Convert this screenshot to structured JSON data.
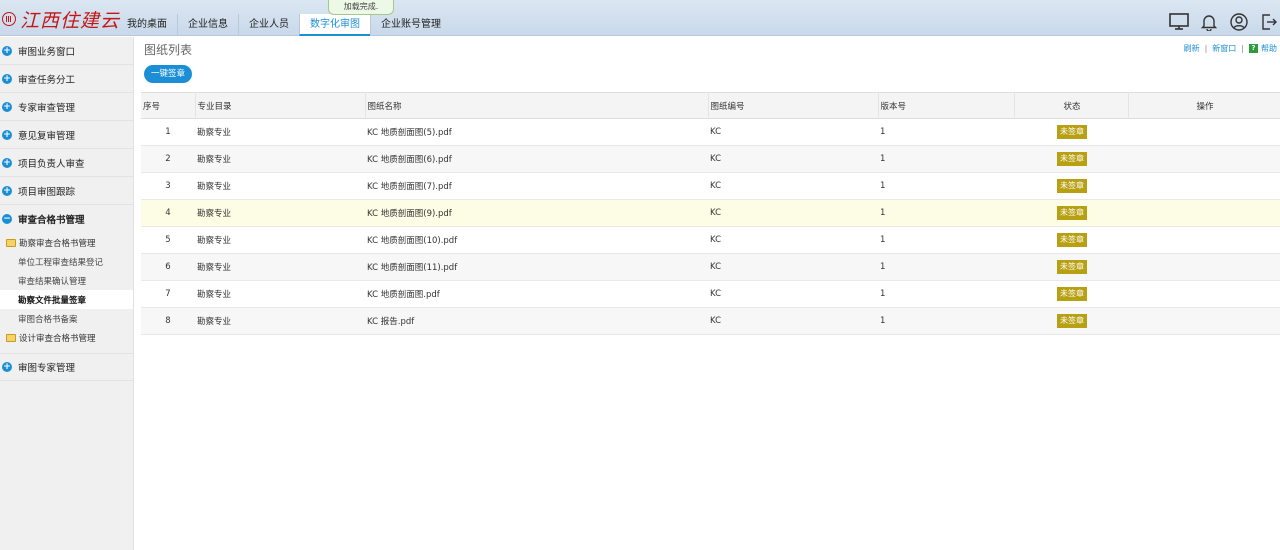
{
  "header": {
    "logo_text": "江西住建云",
    "loading_tip": "加载完成.",
    "nav_tabs": [
      {
        "label": "我的桌面"
      },
      {
        "label": "企业信息"
      },
      {
        "label": "企业人员"
      },
      {
        "label": "数字化审图"
      },
      {
        "label": "企业账号管理"
      }
    ],
    "active_tab": "数字化审图",
    "icons": [
      "monitor-icon",
      "bell-icon",
      "user-icon",
      "logout-icon"
    ]
  },
  "sidebar": {
    "items": [
      {
        "label": "审图业务窗口"
      },
      {
        "label": "审查任务分工"
      },
      {
        "label": "专家审查管理"
      },
      {
        "label": "意见复审管理"
      },
      {
        "label": "项目负责人审查"
      },
      {
        "label": "项目审图跟踪"
      }
    ],
    "expanded": {
      "label": "审查合格书管理",
      "folder1": "勘察审查合格书管理",
      "sub_items": [
        {
          "label": "单位工程审查结果登记"
        },
        {
          "label": "审查结果确认管理"
        },
        {
          "label": "勘察文件批量签章"
        },
        {
          "label": "审图合格书备案"
        }
      ],
      "folder2": "设计审查合格书管理"
    },
    "last_item": {
      "label": "审图专家管理"
    }
  },
  "main": {
    "title": "图纸列表",
    "links": {
      "refresh": "刷新",
      "new_window": "新窗口",
      "help": "帮助"
    },
    "sign_all_button": "一键签章",
    "columns": [
      "序号",
      "专业目录",
      "图纸名称",
      "图纸编号",
      "版本号",
      "状态",
      "操作"
    ],
    "rows": [
      {
        "idx": "1",
        "dir": "勘察专业",
        "name": "KC 地质剖面图(5).pdf",
        "code": "KC",
        "version": "1",
        "status": "未签章"
      },
      {
        "idx": "2",
        "dir": "勘察专业",
        "name": "KC 地质剖面图(6).pdf",
        "code": "KC",
        "version": "1",
        "status": "未签章"
      },
      {
        "idx": "3",
        "dir": "勘察专业",
        "name": "KC 地质剖面图(7).pdf",
        "code": "KC",
        "version": "1",
        "status": "未签章"
      },
      {
        "idx": "4",
        "dir": "勘察专业",
        "name": "KC 地质剖面图(9).pdf",
        "code": "KC",
        "version": "1",
        "status": "未签章"
      },
      {
        "idx": "5",
        "dir": "勘察专业",
        "name": "KC 地质剖面图(10).pdf",
        "code": "KC",
        "version": "1",
        "status": "未签章"
      },
      {
        "idx": "6",
        "dir": "勘察专业",
        "name": "KC 地质剖面图(11).pdf",
        "code": "KC",
        "version": "1",
        "status": "未签章"
      },
      {
        "idx": "7",
        "dir": "勘察专业",
        "name": "KC 地质剖面图.pdf",
        "code": "KC",
        "version": "1",
        "status": "未签章"
      },
      {
        "idx": "8",
        "dir": "勘察专业",
        "name": "KC 报告.pdf",
        "code": "KC",
        "version": "1",
        "status": "未签章"
      }
    ]
  },
  "colors": {
    "accent": "#1b8fd6",
    "logo": "#c31616",
    "badge": "#b8a013",
    "highlight_row": "#fdfde5"
  }
}
